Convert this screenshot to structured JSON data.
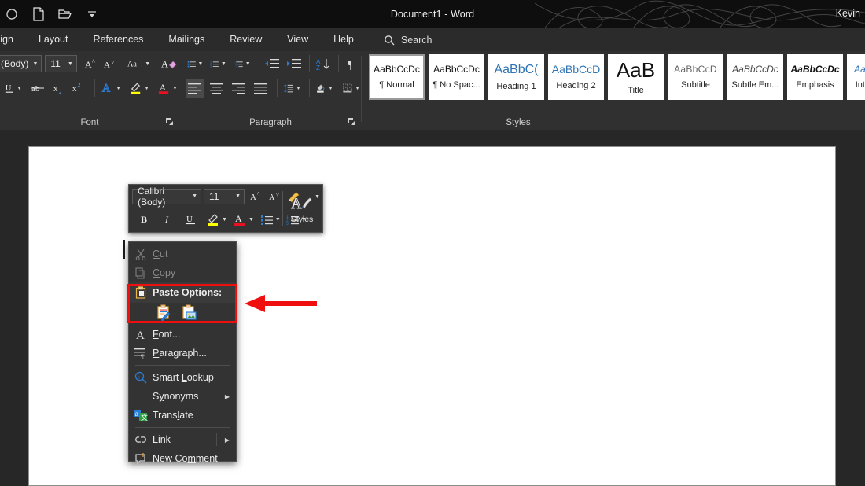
{
  "titlebar": {
    "title": "Document1  -  Word",
    "account": "Kevin",
    "qat": [
      {
        "name": "autosave-toggle-icon",
        "label": "AutoSave"
      },
      {
        "name": "new-document-icon",
        "label": "New"
      },
      {
        "name": "open-folder-icon",
        "label": "Open"
      },
      {
        "name": "customize-quick-access-toolbar-icon",
        "label": "Customize Quick Access Toolbar"
      }
    ]
  },
  "tabs": [
    {
      "label": "sign"
    },
    {
      "label": "Layout"
    },
    {
      "label": "References"
    },
    {
      "label": "Mailings"
    },
    {
      "label": "Review"
    },
    {
      "label": "View"
    },
    {
      "label": "Help"
    }
  ],
  "search": {
    "label": "Search",
    "icon": "search-icon"
  },
  "ribbon": {
    "font_group": {
      "label": "Font",
      "font_name": "(Body)",
      "font_size": "11",
      "buttons": [
        {
          "name": "grow-font-button",
          "label": "A"
        },
        {
          "name": "shrink-font-button",
          "label": "A"
        },
        {
          "name": "change-case-button",
          "label": "Aa"
        },
        {
          "name": "clear-formatting-button",
          "label": "A"
        },
        {
          "name": "underline-button",
          "label": "U"
        },
        {
          "name": "strikethrough-button",
          "label": "ab"
        },
        {
          "name": "subscript-button",
          "label": "x2"
        },
        {
          "name": "superscript-button",
          "label": "x2"
        },
        {
          "name": "text-effects-button",
          "label": "A"
        },
        {
          "name": "text-highlight-color-button",
          "label": "A"
        },
        {
          "name": "font-color-button",
          "label": "A"
        }
      ],
      "dialog_launcher": "font-settings-dialog-launcher"
    },
    "paragraph_group": {
      "label": "Paragraph",
      "buttons": [
        {
          "name": "bullets-button"
        },
        {
          "name": "numbering-button"
        },
        {
          "name": "multilevel-list-button"
        },
        {
          "name": "decrease-indent-button"
        },
        {
          "name": "increase-indent-button"
        },
        {
          "name": "sort-button"
        },
        {
          "name": "show-formatting-marks-button"
        },
        {
          "name": "align-left-button"
        },
        {
          "name": "align-center-button"
        },
        {
          "name": "align-right-button"
        },
        {
          "name": "justify-button"
        },
        {
          "name": "line-spacing-button"
        },
        {
          "name": "shading-button"
        },
        {
          "name": "borders-button"
        }
      ],
      "dialog_launcher": "paragraph-settings-dialog-launcher"
    },
    "styles_group": {
      "label": "Styles",
      "items": [
        {
          "preview": "AaBbCcDc",
          "name": "¶ Normal",
          "selected": true,
          "style": "normal"
        },
        {
          "preview": "AaBbCcDc",
          "name": "¶ No Spac...",
          "selected": false,
          "style": "normal"
        },
        {
          "preview": "AaBbC(",
          "name": "Heading 1",
          "selected": false,
          "style": "h1"
        },
        {
          "preview": "AaBbCcD",
          "name": "Heading 2",
          "selected": false,
          "style": "h2"
        },
        {
          "preview": "AaB",
          "name": "Title",
          "selected": false,
          "style": "title"
        },
        {
          "preview": "AaBbCcD",
          "name": "Subtitle",
          "selected": false,
          "style": "subtitle"
        },
        {
          "preview": "AaBbCcDc",
          "name": "Subtle Em...",
          "selected": false,
          "style": "subtle-em"
        },
        {
          "preview": "AaBbCcDc",
          "name": "Emphasis",
          "selected": false,
          "style": "emphasis"
        },
        {
          "preview": "AaBbCcD",
          "name": "Intense E.",
          "selected": false,
          "style": "intense-em"
        }
      ]
    }
  },
  "mini_toolbar": {
    "font_name": "Calibri (Body)",
    "font_size": "11",
    "styles_label": "Styles",
    "buttons": [
      {
        "name": "grow-font-button"
      },
      {
        "name": "shrink-font-button"
      },
      {
        "name": "format-painter-button"
      },
      {
        "name": "bold-button",
        "label": "B"
      },
      {
        "name": "italic-button",
        "label": "I"
      },
      {
        "name": "underline-button",
        "label": "U"
      },
      {
        "name": "text-highlight-color-button"
      },
      {
        "name": "font-color-button"
      },
      {
        "name": "bullets-button"
      },
      {
        "name": "numbering-button"
      }
    ]
  },
  "context_menu": {
    "items": [
      {
        "label": "Cut",
        "icon": "cut-icon",
        "disabled": true,
        "accel_at": 1,
        "kind": "item"
      },
      {
        "label": "Copy",
        "icon": "copy-icon",
        "disabled": true,
        "accel_at": 0,
        "kind": "item"
      },
      {
        "label": "Paste Options:",
        "icon": "paste-icon",
        "disabled": false,
        "kind": "header"
      },
      {
        "kind": "paste-icons",
        "options": [
          {
            "name": "paste-keep-source-formatting-icon",
            "label": "Keep Source Formatting"
          },
          {
            "name": "paste-picture-icon",
            "label": "Picture"
          }
        ]
      },
      {
        "label": "Font...",
        "icon": "font-icon",
        "disabled": false,
        "accel_at": 0,
        "kind": "item"
      },
      {
        "label": "Paragraph...",
        "icon": "paragraph-icon",
        "disabled": false,
        "accel_at": 0,
        "kind": "item"
      },
      {
        "kind": "divider"
      },
      {
        "label": "Smart Lookup",
        "icon": "smart-lookup-icon",
        "disabled": false,
        "accel_at": 6,
        "kind": "item"
      },
      {
        "label": "Synonyms",
        "icon": null,
        "disabled": false,
        "accel_at": 1,
        "kind": "item",
        "submenu": true
      },
      {
        "label": "Translate",
        "icon": "translate-icon",
        "disabled": false,
        "accel_at": 4,
        "kind": "item"
      },
      {
        "kind": "divider"
      },
      {
        "label": "Link",
        "icon": "link-icon",
        "disabled": false,
        "accel_at": 1,
        "kind": "item",
        "submenu": true,
        "split": true
      },
      {
        "label": "New Comment",
        "icon": "new-comment-icon",
        "disabled": false,
        "accel_at": 8,
        "kind": "item"
      }
    ]
  },
  "annotation": {
    "highlight_color": "#ef0f0f",
    "arrow_color": "#ef0f0f",
    "target": "Paste Options:"
  },
  "colors": {
    "titlebar_bg": "#0e0e0e",
    "tabbar_bg": "#2b2b2b",
    "ribbon_bg": "#303030",
    "page_bg": "#ffffff",
    "canvas_bg": "#272727",
    "menu_bg": "#333333",
    "accent_blue": "#2b7cd3",
    "highlight_yellow": "#ffff00",
    "font_color_red": "#e81123"
  }
}
